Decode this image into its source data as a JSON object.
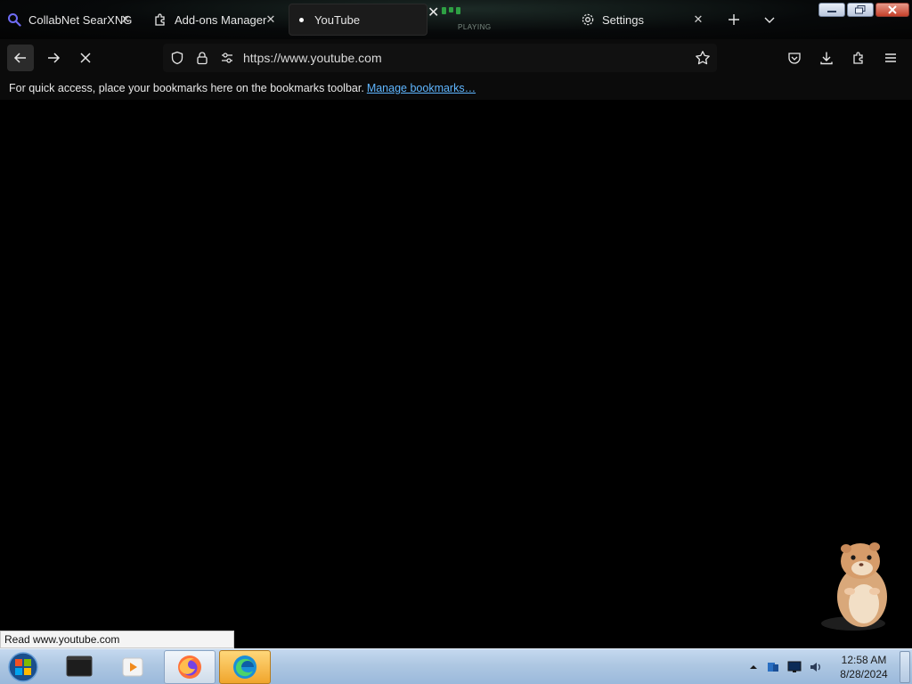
{
  "browser": {
    "tabs": [
      {
        "title": "CollabNet SearXNG",
        "icon": "magnifier-icon"
      },
      {
        "title": "Add-ons Manager",
        "icon": "puzzle-icon"
      },
      {
        "title": "YouTube",
        "icon": "loading-dot"
      },
      {
        "title": "Settings",
        "icon": "gear-icon"
      }
    ],
    "playing_label": "PLAYING",
    "url": "https://www.youtube.com",
    "bookmarks_hint": "For quick access, place your bookmarks here on the bookmarks toolbar.",
    "manage_bookmarks": "Manage bookmarks…",
    "status_text": "Read www.youtube.com"
  },
  "taskbar": {
    "time": "12:58 AM",
    "date": "8/28/2024",
    "items": [
      "start-orb",
      "terminal-app",
      "media-player",
      "firefox",
      "edge"
    ]
  },
  "colors": {
    "accent_link": "#5fb6ff",
    "playing_green": "#2ea043",
    "taskbar_blue": "#aec7e2",
    "close_red": "#c6412b"
  }
}
